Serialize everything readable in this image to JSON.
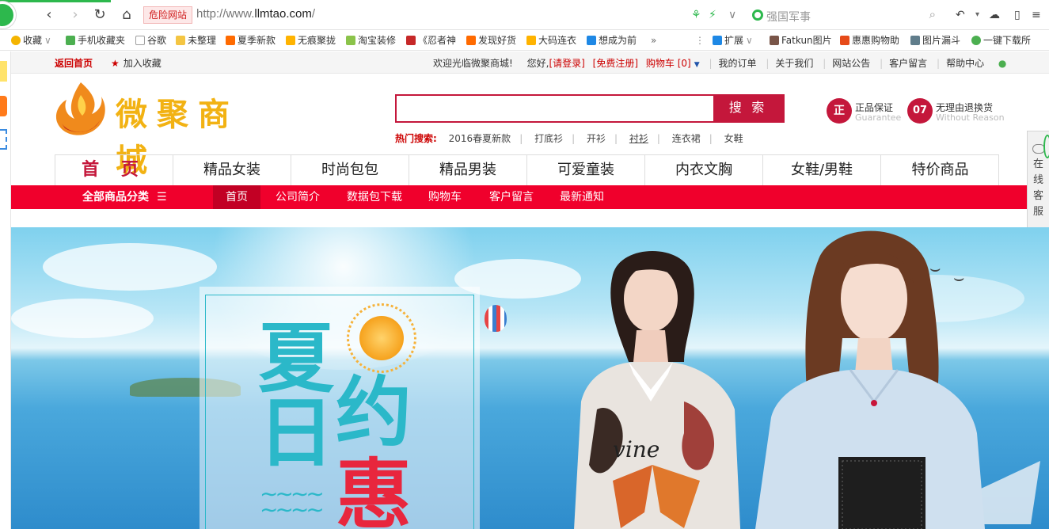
{
  "browser": {
    "danger_label": "危险网站",
    "url_prefix": "http://www.",
    "url_domain": "llmtao.com",
    "url_suffix": "/",
    "search_placeholder": "强国军事"
  },
  "bookmarks": [
    {
      "label": "收藏",
      "color": "#f4b400"
    },
    {
      "label": "手机收藏夹",
      "color": "#4caf50"
    },
    {
      "label": "谷歌",
      "color": "#9e9e9e"
    },
    {
      "label": "未整理",
      "color": "#f4c542"
    },
    {
      "label": "夏季新款",
      "color": "#ff6a00"
    },
    {
      "label": "无痕聚拢",
      "color": "#ffb300"
    },
    {
      "label": "淘宝装修",
      "color": "#8bc34a"
    },
    {
      "label": "《忍者神",
      "color": "#c62828"
    },
    {
      "label": "发现好货",
      "color": "#ff6a00"
    },
    {
      "label": "大码连衣",
      "color": "#ffb300"
    },
    {
      "label": "想成为前",
      "color": "#1e88e5"
    },
    {
      "label": "»",
      "color": ""
    },
    {
      "label": "扩展",
      "color": "#1e88e5"
    },
    {
      "label": "Fatkun图片",
      "color": "#795548"
    },
    {
      "label": "惠惠购物助",
      "color": "#e64a19"
    },
    {
      "label": "图片漏斗",
      "color": "#607d8b"
    },
    {
      "label": "一键下载所",
      "color": "#4caf50"
    }
  ],
  "topbar": {
    "back_home": "返回首页",
    "favorite": "加入收藏",
    "welcome": "欢迎光临微聚商城!",
    "hello": "您好,",
    "login": "[请登录]",
    "register": "[免费注册]",
    "cart": "购物车 [0]",
    "links": [
      "我的订单",
      "关于我们",
      "网站公告",
      "客户留言",
      "帮助中心"
    ]
  },
  "logo": {
    "name": "微聚商城"
  },
  "search": {
    "button": "搜 索",
    "hot_label": "热门搜索:",
    "hot_keywords": [
      "2016春夏新款",
      "打底衫",
      "开衫",
      "衬衫",
      "连衣裙",
      "女鞋"
    ]
  },
  "guarantees": [
    {
      "badge": "正",
      "title": "正品保证",
      "sub": "Guarantee"
    },
    {
      "badge": "07",
      "title": "无理由退换货",
      "sub": "Without Reason"
    }
  ],
  "main_nav": [
    "首 页",
    "精品女装",
    "时尚包包",
    "精品男装",
    "可爱童装",
    "内衣文胸",
    "女鞋/男鞋",
    "特价商品"
  ],
  "sub_nav": {
    "all_label": "全部商品分类",
    "links": [
      "首页",
      "公司简介",
      "数据包下载",
      "购物车",
      "客户留言",
      "最新通知"
    ]
  },
  "service": {
    "label": "在线客服"
  },
  "banner": {
    "chars": [
      "夏",
      "日",
      "约",
      "惠"
    ],
    "colors": {
      "teal": "#2bb8c9",
      "red": "#e8263d"
    }
  }
}
